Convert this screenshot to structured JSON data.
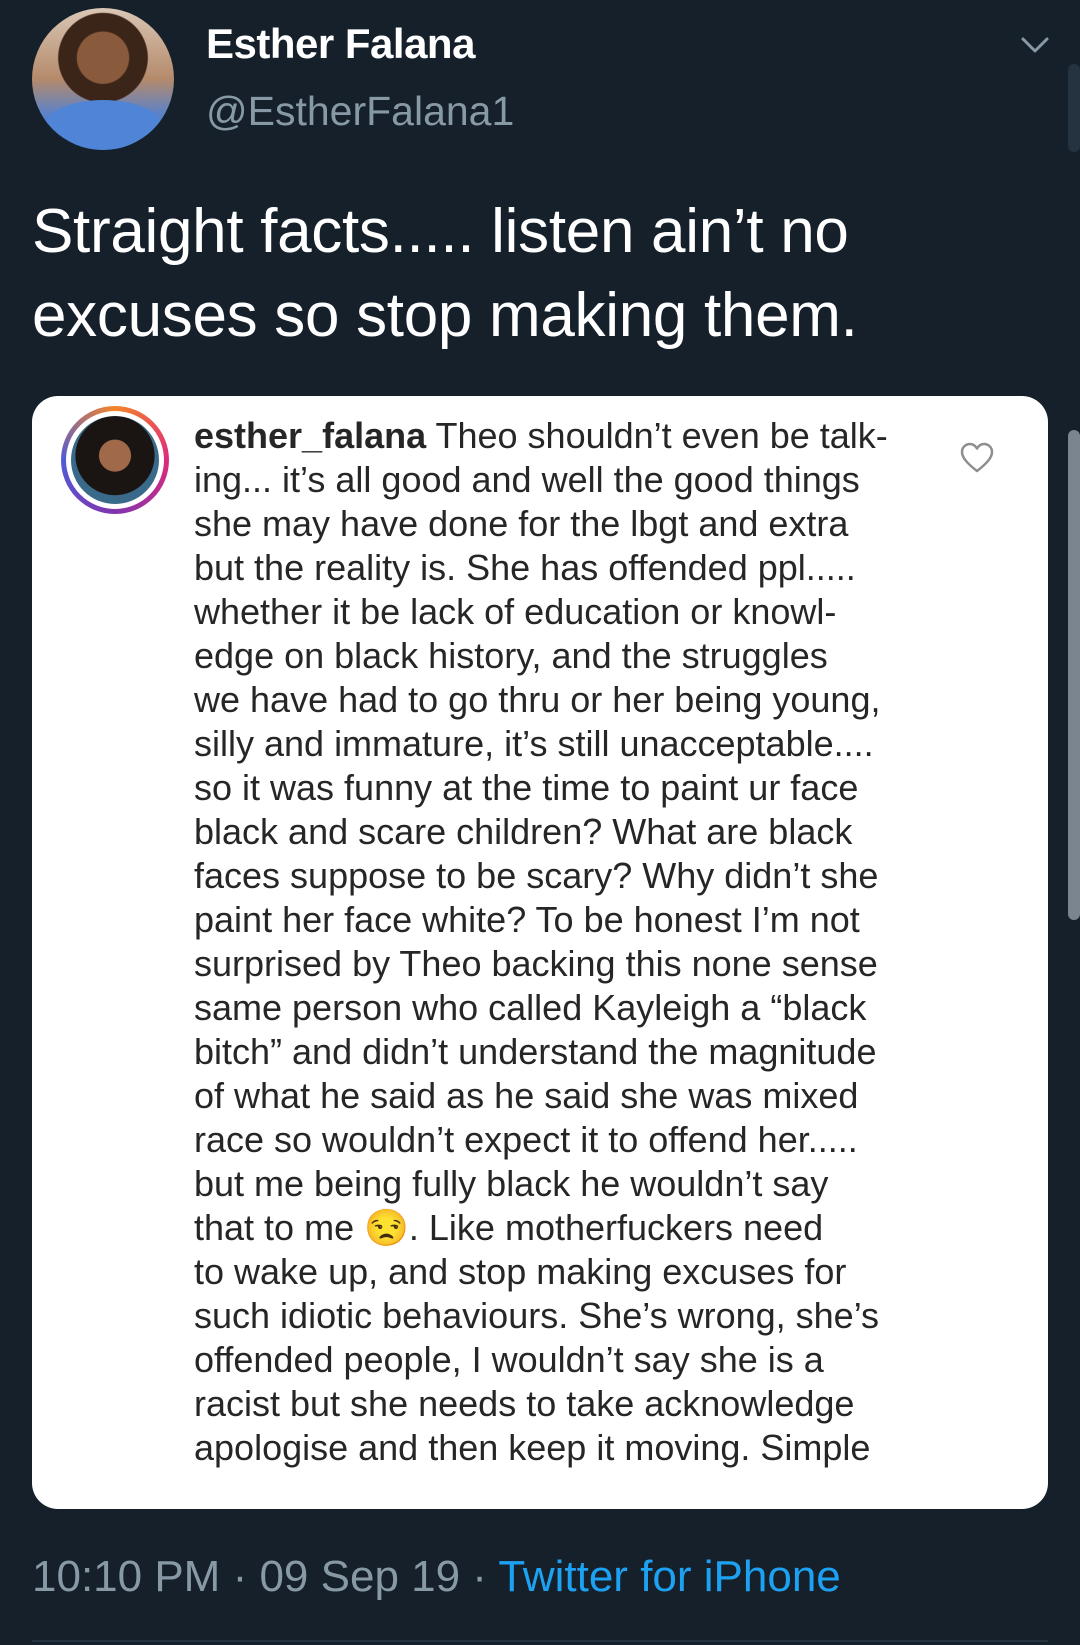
{
  "tweet": {
    "display_name": "Esther Falana",
    "handle": "@EstherFalana1",
    "text": "Straight facts..... listen ain’t no excuses so stop making them.",
    "time": "10:10 PM",
    "separator": " · ",
    "date": "09 Sep 19",
    "source": "Twitter for iPhone"
  },
  "instagram_comment": {
    "username": "esther_falana",
    "lines": [
      "Theo shouldn’t even be talk-",
      "ing... it’s all good and well the good things",
      "she may have done for the lbgt and extra",
      "but the reality is. She has offended ppl.....",
      "whether it be lack of education or knowl-",
      "edge on black history, and the struggles",
      "we have had to go thru or her being young,",
      "silly and immature, it’s still unacceptable....",
      "so it was funny at the time to paint ur face",
      "black and scare children? What are black",
      "faces suppose to be scary? Why didn’t she",
      "paint her face white? To be honest I’m not",
      "surprised by Theo backing this none sense",
      "same person who called Kayleigh a “black",
      "bitch” and didn’t understand the magnitude",
      "of what he said as he said she was mixed",
      "race so wouldn’t expect it to offend her.....",
      "but me being fully black he wouldn’t say",
      "that to me 😒. Like motherfuckers need",
      "to wake up, and stop making excuses for",
      "such idiotic behaviours. She’s wrong, she’s",
      "offended people, I wouldn’t say she is a",
      "racist but she needs to take acknowledge",
      "apologise and then keep it moving. Simple"
    ]
  },
  "icons": {
    "menu": "chevron-down-icon",
    "like": "heart-icon"
  },
  "colors": {
    "background": "#15202b",
    "secondary_text": "#8899a6",
    "link": "#1da1f2",
    "card": "#ffffff",
    "card_text": "#262626"
  }
}
